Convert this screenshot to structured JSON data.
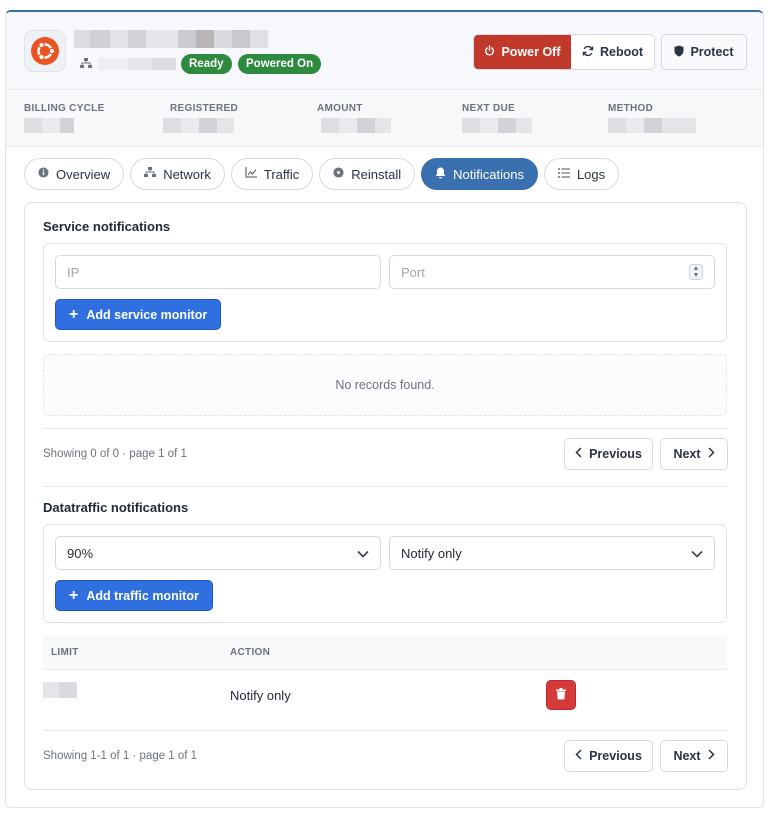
{
  "server": {
    "status_ready": "Ready",
    "status_power": "Powered On"
  },
  "actions": {
    "power_off": "Power Off",
    "reboot": "Reboot",
    "protect": "Protect"
  },
  "billing": {
    "labels": [
      "BILLING CYCLE",
      "REGISTERED",
      "AMOUNT",
      "NEXT DUE",
      "METHOD"
    ]
  },
  "tabs": [
    {
      "label": "Overview",
      "icon": "info-icon"
    },
    {
      "label": "Network",
      "icon": "network-icon"
    },
    {
      "label": "Traffic",
      "icon": "chart-icon"
    },
    {
      "label": "Reinstall",
      "icon": "disc-icon"
    },
    {
      "label": "Notifications",
      "icon": "bell-icon",
      "active": true
    },
    {
      "label": "Logs",
      "icon": "list-icon"
    }
  ],
  "service": {
    "title": "Service notifications",
    "ip_placeholder": "IP",
    "port_placeholder": "Port",
    "add_button": "Add service monitor",
    "empty_text": "No records found.",
    "pager_text": "Showing 0 of 0 · page 1 of 1",
    "prev": "Previous",
    "next": "Next"
  },
  "traffic": {
    "title": "Datatraffic notifications",
    "limit_value": "90%",
    "action_value": "Notify only",
    "add_button": "Add traffic monitor",
    "columns": [
      "LIMIT",
      "ACTION"
    ],
    "rows": [
      {
        "action": "Notify only"
      }
    ],
    "pager_text": "Showing 1-1 of 1 · page 1 of 1",
    "prev": "Previous",
    "next": "Next"
  },
  "colors": {
    "accent": "#3a6fb0",
    "primary_button": "#2f6fe0",
    "danger": "#c0392b",
    "success": "#2d8a3e"
  }
}
